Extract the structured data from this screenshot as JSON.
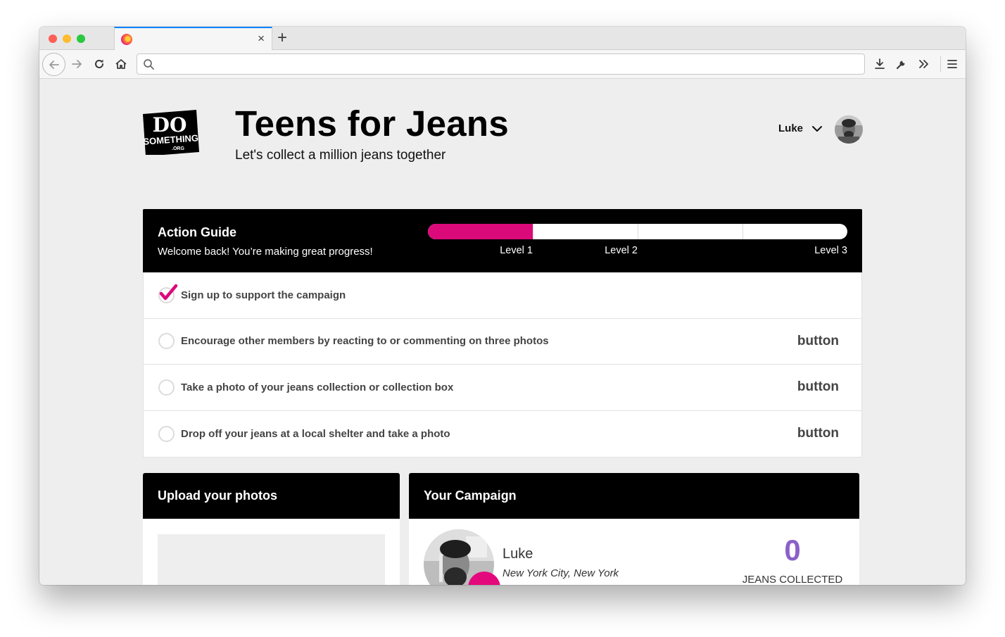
{
  "browser": {
    "tab": {
      "title": "",
      "favicon": "firefox-icon",
      "close_icon": "×"
    },
    "new_tab_icon": "+",
    "url_bar": {
      "value": "",
      "placeholder": ""
    },
    "toolbar_icons": [
      "back-icon",
      "forward-icon",
      "reload-icon",
      "home-icon",
      "download-icon",
      "wrench-icon",
      "overflow-icon",
      "hamburger-menu-icon"
    ]
  },
  "header": {
    "logo": {
      "line1": "DO",
      "line2": "SOMETHING",
      "line3": ".ORG"
    },
    "title": "Teens for Jeans",
    "subtitle": "Let's collect a million jeans together",
    "user": {
      "name": "Luke"
    }
  },
  "action_guide": {
    "title": "Action Guide",
    "subtitle": "Welcome back! You’re making great progress!",
    "progress_fraction": 0.25,
    "progress_segments": 4,
    "accent_color": "#db0a7a",
    "levels": [
      {
        "label": "Level 1",
        "at": 0.25
      },
      {
        "label": "Level 2",
        "at": 0.5
      },
      {
        "label": "Level 3",
        "at": 1.0
      }
    ],
    "items": [
      {
        "label": "Sign up to support the campaign",
        "done": true,
        "button": ""
      },
      {
        "label": "Encourage other members by reacting to or commenting on three photos",
        "done": false,
        "button": "button"
      },
      {
        "label": "Take a photo of your jeans collection or collection box",
        "done": false,
        "button": "button"
      },
      {
        "label": "Drop off your jeans at a local shelter and take a photo",
        "done": false,
        "button": "button"
      }
    ]
  },
  "upload_card": {
    "title": "Upload your photos"
  },
  "campaign_card": {
    "title": "Your Campaign",
    "name": "Luke",
    "location": "New York City, New York",
    "jeans_count": "0",
    "jeans_label": "JEANS COLLECTED",
    "count_color": "#8a60c9"
  }
}
